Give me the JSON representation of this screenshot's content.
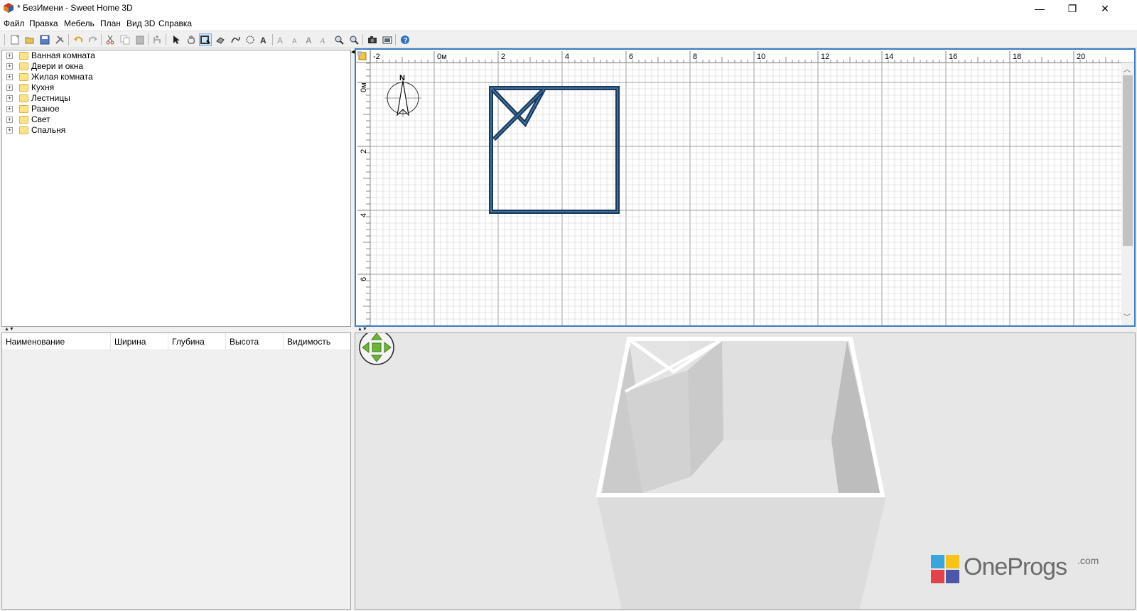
{
  "window": {
    "title": "* БезИмени - Sweet Home 3D",
    "minimize_glyph": "—",
    "maximize_glyph": "❐",
    "close_glyph": "✕"
  },
  "menu": [
    "Файл",
    "Правка",
    "Мебель",
    "План",
    "Вид 3D",
    "Справка"
  ],
  "toolbar": {
    "icons": [
      "new-home-icon",
      "open-icon",
      "save-icon",
      "preferences-icon",
      "undo-icon",
      "redo-icon",
      "cut-icon",
      "copy-icon",
      "paste-icon",
      "add-furniture-icon",
      "select-mode-icon",
      "pan-mode-icon",
      "create-walls-icon",
      "create-rooms-icon",
      "create-polylines-icon",
      "create-dimensions-icon",
      "create-labels-icon",
      "increase-text-size-icon",
      "decrease-text-size-icon",
      "bold-text-icon",
      "italic-text-icon",
      "zoom-in-icon",
      "zoom-out-icon",
      "create-photo-icon",
      "create-video-icon",
      "help-icon"
    ]
  },
  "catalog": {
    "expander_glyph": "+",
    "categories": [
      "Ванная комната",
      "Двери и окна",
      "Жилая комната",
      "Кухня",
      "Лестницы",
      "Разное",
      "Свет",
      "Спальня"
    ]
  },
  "furniture_table": {
    "columns": [
      "Наименование",
      "Ширина",
      "Глубина",
      "Высота",
      "Видимость"
    ]
  },
  "plan": {
    "ruler_x_labels": [
      "-2",
      "0м",
      "2",
      "4",
      "6",
      "8",
      "10",
      "12",
      "14",
      "16",
      "18",
      "20"
    ],
    "ruler_y_labels": [
      "0м",
      "2",
      "4",
      "6"
    ],
    "compass_label": "N",
    "wall_color": "#1a3a5c",
    "grid_minor_color": "#d0d0d0",
    "grid_major_color": "#a0a0a0",
    "accent_color": "#3c7fc0"
  },
  "view3d": {
    "navigator_icon": "navigation-arrows-icon",
    "watermark_text": "OneProgs",
    "watermark_suffix": ".com"
  }
}
